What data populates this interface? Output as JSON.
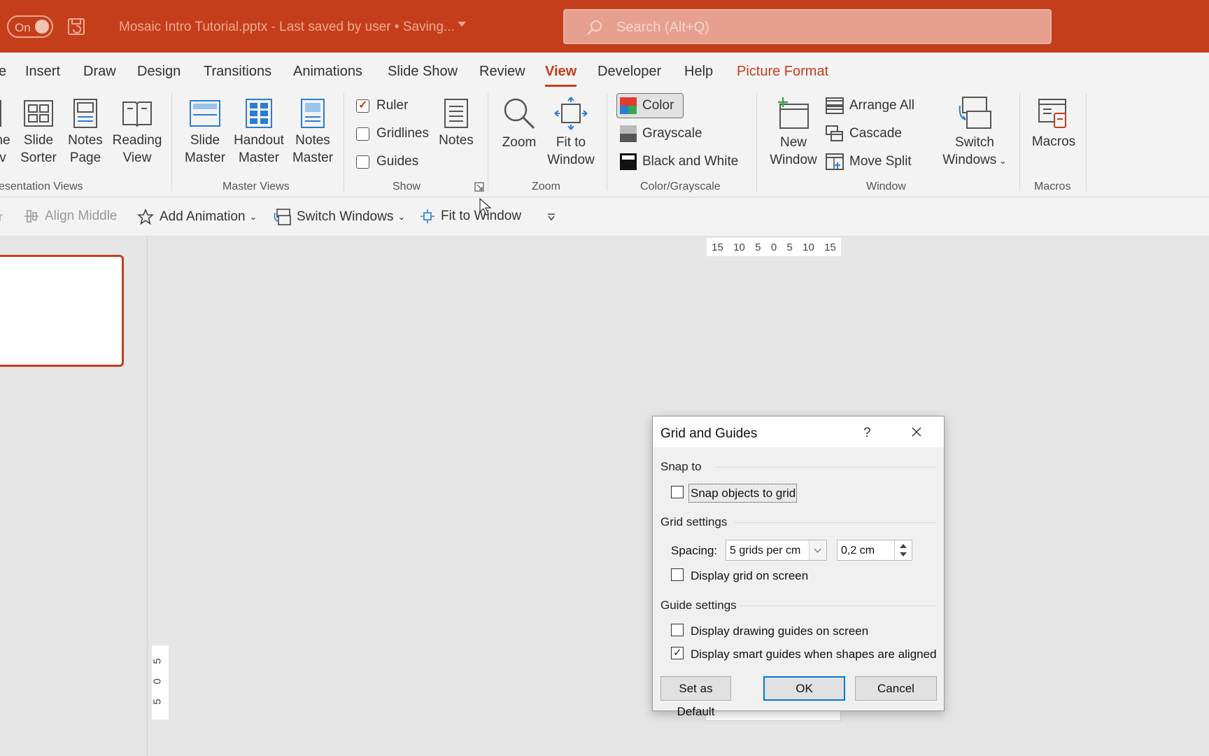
{
  "titlebar": {
    "autosave_label": "On",
    "doc_title": "Mosaic Intro Tutorial.pptx  -  Last saved by user • Saving...",
    "search_placeholder": "Search (Alt+Q)"
  },
  "tabs": [
    {
      "label": "e"
    },
    {
      "label": "Insert"
    },
    {
      "label": "Draw"
    },
    {
      "label": "Design"
    },
    {
      "label": "Transitions"
    },
    {
      "label": "Animations"
    },
    {
      "label": "Slide Show"
    },
    {
      "label": "Review"
    },
    {
      "label": "View"
    },
    {
      "label": "Developer"
    },
    {
      "label": "Help"
    },
    {
      "label": "Picture Format"
    }
  ],
  "ribbon": {
    "presentation_views": {
      "label": "esentation Views",
      "buttons": [
        {
          "line1": "ne",
          "line2": "v"
        },
        {
          "line1": "Slide",
          "line2": "Sorter"
        },
        {
          "line1": "Notes",
          "line2": "Page"
        },
        {
          "line1": "Reading",
          "line2": "View"
        }
      ]
    },
    "master_views": {
      "label": "Master Views",
      "buttons": [
        {
          "line1": "Slide",
          "line2": "Master"
        },
        {
          "line1": "Handout",
          "line2": "Master"
        },
        {
          "line1": "Notes",
          "line2": "Master"
        }
      ]
    },
    "show": {
      "label": "Show",
      "ruler": "Ruler",
      "gridlines": "Gridlines",
      "guides": "Guides",
      "notes": "Notes"
    },
    "zoom": {
      "label": "Zoom",
      "zoom": "Zoom",
      "fit_line1": "Fit to",
      "fit_line2": "Window"
    },
    "color_grayscale": {
      "label": "Color/Grayscale",
      "color": "Color",
      "grayscale": "Grayscale",
      "black_white": "Black and White"
    },
    "window": {
      "label": "Window",
      "new_line1": "New",
      "new_line2": "Window",
      "arrange_all": "Arrange All",
      "cascade": "Cascade",
      "move_split": "Move Split",
      "switch_line1": "Switch",
      "switch_line2": "Windows"
    },
    "macros": {
      "label": "Macros",
      "macros": "Macros"
    }
  },
  "qat": {
    "align_middle": "Align Middle",
    "add_animation": "Add Animation",
    "switch_windows": "Switch Windows",
    "fit_to_window": "Fit to Window"
  },
  "ruler": {
    "h_ticks": [
      "15",
      "10",
      "5",
      "0",
      "5",
      "10",
      "15"
    ],
    "v_ticks": [
      "5",
      "0",
      "5"
    ]
  },
  "dialog": {
    "title": "Grid and Guides",
    "help": "?",
    "snap_to": "Snap to",
    "snap_objects": "Snap objects to grid",
    "grid_settings": "Grid settings",
    "spacing_label": "Spacing:",
    "spacing_value": "5 grids per cm",
    "spacing_number": "0,2 cm",
    "display_grid": "Display grid on screen",
    "guide_settings": "Guide settings",
    "display_drawing_guides": "Display drawing guides on screen",
    "display_smart_guides": "Display smart guides when shapes are aligned",
    "set_default": "Set as Default",
    "ok": "OK",
    "cancel": "Cancel",
    "checks": {
      "snap_objects": false,
      "display_grid": false,
      "display_drawing_guides": false,
      "display_smart_guides": true
    }
  },
  "colors": {
    "accent": "#c43e1c",
    "ribbon_bg": "#f3f3f3",
    "workspace_bg": "#e6e6e6",
    "ok_focus": "#0078d7"
  }
}
